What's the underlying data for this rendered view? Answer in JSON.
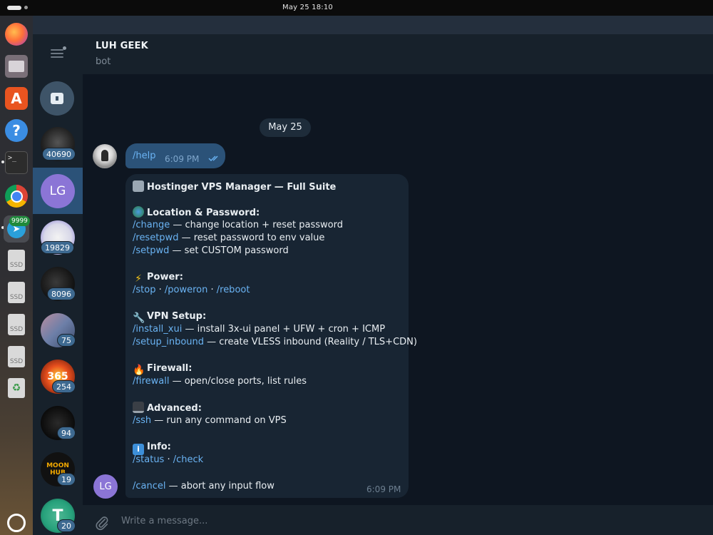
{
  "system": {
    "clock": "May 25  18:10"
  },
  "dock": {
    "items": [
      {
        "name": "firefox-icon",
        "label": ""
      },
      {
        "name": "files-icon",
        "label": ""
      },
      {
        "name": "app-center-icon",
        "label": "A"
      },
      {
        "name": "help-icon",
        "label": "?"
      },
      {
        "name": "terminal-icon",
        "label": ">_"
      },
      {
        "name": "chrome-icon",
        "label": ""
      },
      {
        "name": "telegram-icon",
        "label": ""
      },
      {
        "name": "ssd-drive-icon",
        "label": "SSD"
      },
      {
        "name": "ssd-drive-icon",
        "label": "SSD"
      },
      {
        "name": "ssd-drive-icon",
        "label": "SSD"
      },
      {
        "name": "ssd-drive-icon",
        "label": "SSD"
      },
      {
        "name": "trash-icon",
        "label": "♻"
      },
      {
        "name": "ubuntu-menu-icon",
        "label": ""
      }
    ],
    "telegram_badge": "9999"
  },
  "chat_list": {
    "items": [
      {
        "name": "chat-1",
        "count": "40690"
      },
      {
        "name": "chat-lg",
        "initials": "LG",
        "selected": true
      },
      {
        "name": "chat-3",
        "count": "19829"
      },
      {
        "name": "chat-4",
        "count": "8096"
      },
      {
        "name": "chat-5",
        "count": "75"
      },
      {
        "name": "chat-6",
        "count": "254",
        "avatar_text": "365"
      },
      {
        "name": "chat-7",
        "count": "94"
      },
      {
        "name": "chat-8",
        "count": "19",
        "avatar_text": "MOON HUB"
      },
      {
        "name": "chat-9",
        "count": "20",
        "avatar_text": "T"
      }
    ]
  },
  "chat": {
    "name": "LUH GEEK",
    "status": "bot",
    "date": "May 25",
    "outgoing": {
      "text": "/help",
      "time": "6:09 PM"
    },
    "incoming": {
      "title": "Hostinger VPS Manager — Full Suite",
      "sections": [
        {
          "heading": "Location & Password:",
          "lines": [
            {
              "cmd": "/change",
              "desc": " — change location + reset password"
            },
            {
              "cmd": "/resetpwd",
              "desc": " — reset password to env value"
            },
            {
              "cmd": "/setpwd",
              "desc": " — set CUSTOM password"
            }
          ]
        },
        {
          "heading": "Power:",
          "lines": [
            {
              "cmds": [
                "/stop",
                "/poweron",
                "/reboot"
              ],
              "sep": " · "
            }
          ]
        },
        {
          "heading": "VPN Setup:",
          "lines": [
            {
              "cmd": "/install_xui",
              "desc": " — install 3x-ui panel + UFW + cron + ICMP"
            },
            {
              "cmd": "/setup_inbound",
              "desc": " — create VLESS inbound (Reality / TLS+CDN)"
            }
          ]
        },
        {
          "heading": "Firewall:",
          "lines": [
            {
              "cmd": "/firewall",
              "desc": " — open/close ports, list rules"
            }
          ]
        },
        {
          "heading": "Advanced:",
          "lines": [
            {
              "cmd": "/ssh",
              "desc": " — run any command on VPS"
            }
          ]
        },
        {
          "heading": "Info:",
          "lines": [
            {
              "cmds": [
                "/status",
                "/check"
              ],
              "sep": " · "
            }
          ]
        }
      ],
      "footer": {
        "cmd": "/cancel",
        "desc": " — abort any input flow"
      },
      "time": "6:09 PM"
    },
    "sender_initials": "LG"
  },
  "composer": {
    "placeholder": "Write a message..."
  }
}
